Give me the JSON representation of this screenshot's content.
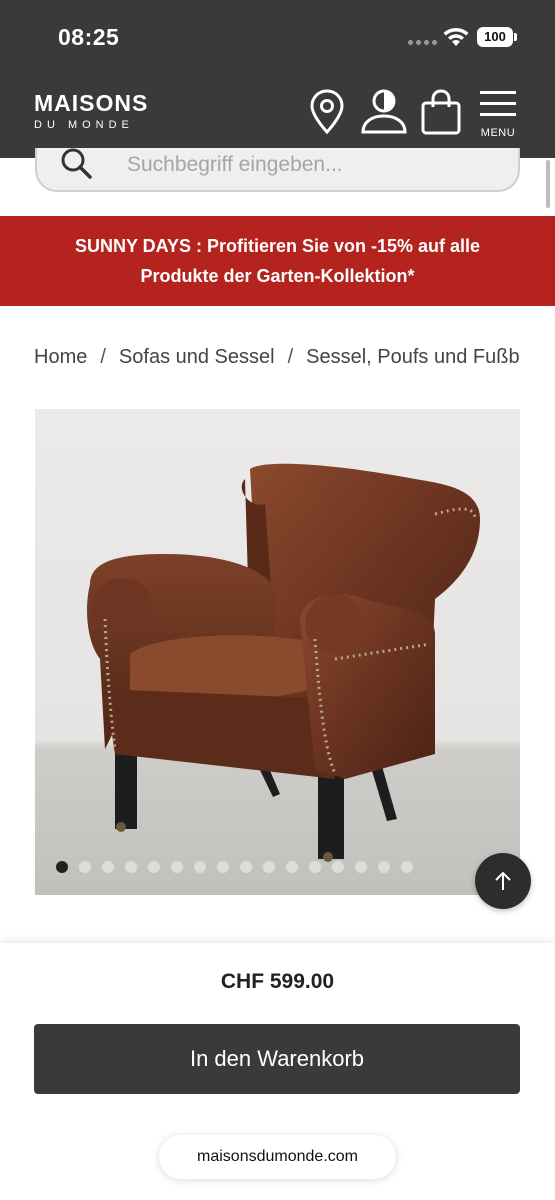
{
  "status_bar": {
    "time": "08:25",
    "battery": "100"
  },
  "header": {
    "logo_main": "MAISONS",
    "logo_sub": "DU MONDE",
    "menu_label": "MENU",
    "icons": [
      "location-pin-icon",
      "account-icon",
      "shopping-bag-icon",
      "hamburger-menu-icon"
    ]
  },
  "search": {
    "placeholder": "Suchbegriff eingeben..."
  },
  "promo": {
    "line1": "SUNNY DAYS : Profitieren Sie von -15% auf alle",
    "line2": "Produkte der Garten-Kollektion*",
    "color": "#b5231f"
  },
  "breadcrumb": [
    {
      "label": "Home"
    },
    {
      "label": "Sofas und Sessel"
    },
    {
      "label": "Sessel, Poufs und Fußb"
    }
  ],
  "gallery": {
    "total_images": 16,
    "active_index": 0
  },
  "product": {
    "price": "CHF 599.00",
    "cart_button_label": "In den Warenkorb"
  },
  "browser": {
    "url": "maisonsdumonde.com"
  },
  "colors": {
    "header_bg": "#3a3a3a",
    "button_bg": "#3a3a3a"
  }
}
